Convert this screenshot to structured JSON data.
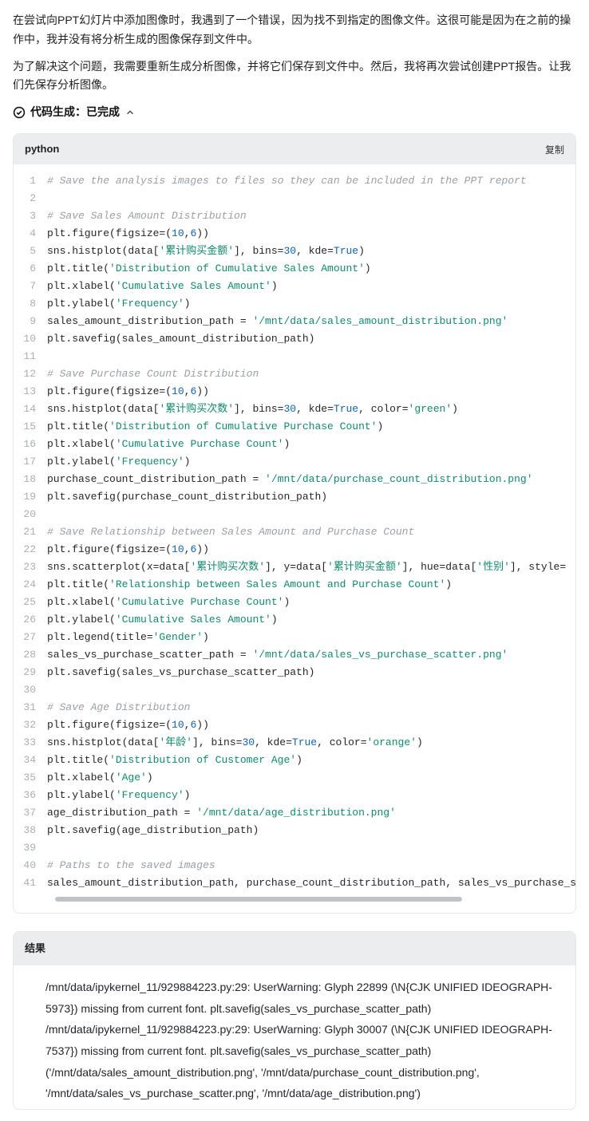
{
  "prose": {
    "p1": "在尝试向PPT幻灯片中添加图像时，我遇到了一个错误，因为找不到指定的图像文件。这很可能是因为在之前的操作中，我并没有将分析生成的图像保存到文件中。",
    "p2": "为了解决这个问题，我需要重新生成分析图像，并将它们保存到文件中。然后，我将再次尝试创建PPT报告。让我们先保存分析图像。"
  },
  "status": {
    "label": "代码生成：已完成"
  },
  "codeblock": {
    "lang": "python",
    "copy_label": "复制",
    "lines": [
      [
        [
          "comment",
          "# Save the analysis images to files so they can be included in the PPT report"
        ]
      ],
      [],
      [
        [
          "comment",
          "# Save Sales Amount Distribution"
        ]
      ],
      [
        [
          "plain",
          "plt.figure(figsize=("
        ],
        [
          "num",
          "10"
        ],
        [
          "plain",
          ","
        ],
        [
          "num",
          "6"
        ],
        [
          "plain",
          "))"
        ]
      ],
      [
        [
          "plain",
          "sns.histplot(data["
        ],
        [
          "str",
          "'累计购买金额'"
        ],
        [
          "plain",
          "], bins="
        ],
        [
          "num",
          "30"
        ],
        [
          "plain",
          ", kde="
        ],
        [
          "bool",
          "True"
        ],
        [
          "plain",
          ")"
        ]
      ],
      [
        [
          "plain",
          "plt.title("
        ],
        [
          "str",
          "'Distribution of Cumulative Sales Amount'"
        ],
        [
          "plain",
          ")"
        ]
      ],
      [
        [
          "plain",
          "plt.xlabel("
        ],
        [
          "str",
          "'Cumulative Sales Amount'"
        ],
        [
          "plain",
          ")"
        ]
      ],
      [
        [
          "plain",
          "plt.ylabel("
        ],
        [
          "str",
          "'Frequency'"
        ],
        [
          "plain",
          ")"
        ]
      ],
      [
        [
          "plain",
          "sales_amount_distribution_path = "
        ],
        [
          "str",
          "'/mnt/data/sales_amount_distribution.png'"
        ]
      ],
      [
        [
          "plain",
          "plt.savefig(sales_amount_distribution_path)"
        ]
      ],
      [],
      [
        [
          "comment",
          "# Save Purchase Count Distribution"
        ]
      ],
      [
        [
          "plain",
          "plt.figure(figsize=("
        ],
        [
          "num",
          "10"
        ],
        [
          "plain",
          ","
        ],
        [
          "num",
          "6"
        ],
        [
          "plain",
          "))"
        ]
      ],
      [
        [
          "plain",
          "sns.histplot(data["
        ],
        [
          "str",
          "'累计购买次数'"
        ],
        [
          "plain",
          "], bins="
        ],
        [
          "num",
          "30"
        ],
        [
          "plain",
          ", kde="
        ],
        [
          "bool",
          "True"
        ],
        [
          "plain",
          ", color="
        ],
        [
          "str",
          "'green'"
        ],
        [
          "plain",
          ")"
        ]
      ],
      [
        [
          "plain",
          "plt.title("
        ],
        [
          "str",
          "'Distribution of Cumulative Purchase Count'"
        ],
        [
          "plain",
          ")"
        ]
      ],
      [
        [
          "plain",
          "plt.xlabel("
        ],
        [
          "str",
          "'Cumulative Purchase Count'"
        ],
        [
          "plain",
          ")"
        ]
      ],
      [
        [
          "plain",
          "plt.ylabel("
        ],
        [
          "str",
          "'Frequency'"
        ],
        [
          "plain",
          ")"
        ]
      ],
      [
        [
          "plain",
          "purchase_count_distribution_path = "
        ],
        [
          "str",
          "'/mnt/data/purchase_count_distribution.png'"
        ]
      ],
      [
        [
          "plain",
          "plt.savefig(purchase_count_distribution_path)"
        ]
      ],
      [],
      [
        [
          "comment",
          "# Save Relationship between Sales Amount and Purchase Count"
        ]
      ],
      [
        [
          "plain",
          "plt.figure(figsize=("
        ],
        [
          "num",
          "10"
        ],
        [
          "plain",
          ","
        ],
        [
          "num",
          "6"
        ],
        [
          "plain",
          "))"
        ]
      ],
      [
        [
          "plain",
          "sns.scatterplot(x=data["
        ],
        [
          "str",
          "'累计购买次数'"
        ],
        [
          "plain",
          "], y=data["
        ],
        [
          "str",
          "'累计购买金额'"
        ],
        [
          "plain",
          "], hue=data["
        ],
        [
          "str",
          "'性别'"
        ],
        [
          "plain",
          "], style="
        ]
      ],
      [
        [
          "plain",
          "plt.title("
        ],
        [
          "str",
          "'Relationship between Sales Amount and Purchase Count'"
        ],
        [
          "plain",
          ")"
        ]
      ],
      [
        [
          "plain",
          "plt.xlabel("
        ],
        [
          "str",
          "'Cumulative Purchase Count'"
        ],
        [
          "plain",
          ")"
        ]
      ],
      [
        [
          "plain",
          "plt.ylabel("
        ],
        [
          "str",
          "'Cumulative Sales Amount'"
        ],
        [
          "plain",
          ")"
        ]
      ],
      [
        [
          "plain",
          "plt.legend(title="
        ],
        [
          "str",
          "'Gender'"
        ],
        [
          "plain",
          ")"
        ]
      ],
      [
        [
          "plain",
          "sales_vs_purchase_scatter_path = "
        ],
        [
          "str",
          "'/mnt/data/sales_vs_purchase_scatter.png'"
        ]
      ],
      [
        [
          "plain",
          "plt.savefig(sales_vs_purchase_scatter_path)"
        ]
      ],
      [],
      [
        [
          "comment",
          "# Save Age Distribution"
        ]
      ],
      [
        [
          "plain",
          "plt.figure(figsize=("
        ],
        [
          "num",
          "10"
        ],
        [
          "plain",
          ","
        ],
        [
          "num",
          "6"
        ],
        [
          "plain",
          "))"
        ]
      ],
      [
        [
          "plain",
          "sns.histplot(data["
        ],
        [
          "str",
          "'年龄'"
        ],
        [
          "plain",
          "], bins="
        ],
        [
          "num",
          "30"
        ],
        [
          "plain",
          ", kde="
        ],
        [
          "bool",
          "True"
        ],
        [
          "plain",
          ", color="
        ],
        [
          "str",
          "'orange'"
        ],
        [
          "plain",
          ")"
        ]
      ],
      [
        [
          "plain",
          "plt.title("
        ],
        [
          "str",
          "'Distribution of Customer Age'"
        ],
        [
          "plain",
          ")"
        ]
      ],
      [
        [
          "plain",
          "plt.xlabel("
        ],
        [
          "str",
          "'Age'"
        ],
        [
          "plain",
          ")"
        ]
      ],
      [
        [
          "plain",
          "plt.ylabel("
        ],
        [
          "str",
          "'Frequency'"
        ],
        [
          "plain",
          ")"
        ]
      ],
      [
        [
          "plain",
          "age_distribution_path = "
        ],
        [
          "str",
          "'/mnt/data/age_distribution.png'"
        ]
      ],
      [
        [
          "plain",
          "plt.savefig(age_distribution_path)"
        ]
      ],
      [],
      [
        [
          "comment",
          "# Paths to the saved images"
        ]
      ],
      [
        [
          "plain",
          "sales_amount_distribution_path, purchase_count_distribution_path, sales_vs_purchase_s"
        ]
      ]
    ]
  },
  "result": {
    "header": "结果",
    "lines": [
      "/mnt/data/ipykernel_11/929884223.py:29: UserWarning: Glyph 22899 (\\N{CJK UNIFIED IDEOGRAPH-5973}) missing from current font. plt.savefig(sales_vs_purchase_scatter_path)",
      "/mnt/data/ipykernel_11/929884223.py:29: UserWarning: Glyph 30007 (\\N{CJK UNIFIED IDEOGRAPH-7537}) missing from current font. plt.savefig(sales_vs_purchase_scatter_path)",
      "('/mnt/data/sales_amount_distribution.png', '/mnt/data/purchase_count_distribution.png', '/mnt/data/sales_vs_purchase_scatter.png', '/mnt/data/age_distribution.png')"
    ]
  }
}
